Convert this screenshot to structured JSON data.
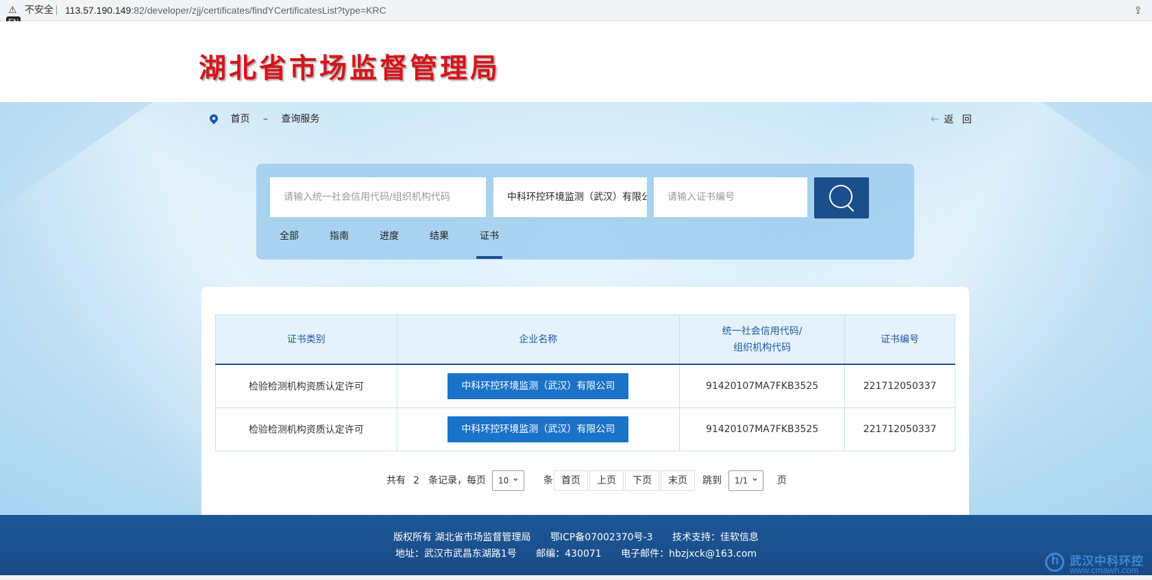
{
  "browser": {
    "warning_icon": "warning-triangle-icon",
    "insecure_label": "不安全",
    "url_host": "113.57.190.149",
    "url_rest": ":82/developer/zjj/certificates/findYCertificatesList?type=KRC",
    "share_icon": "share-icon",
    "ime_badge": "EN"
  },
  "header": {
    "title": "湖北省市场监督管理局",
    "title_color": "#d5141b"
  },
  "breadcrumb": {
    "icon": "location-pin-icon",
    "home": "首页",
    "separator": "–",
    "current": "查询服务"
  },
  "back": {
    "icon": "arrow-left-icon",
    "label": "返 回"
  },
  "search": {
    "credit_code_placeholder": "请输入统一社会信用代码/组织机构代码",
    "company_value": "中科环控环境监测（武汉）有限公司",
    "certificate_placeholder": "请输入证书编号",
    "search_icon": "search-icon",
    "button_color": "#1a4f8c"
  },
  "tabs": [
    {
      "label": "全部"
    },
    {
      "label": "指南"
    },
    {
      "label": "进度"
    },
    {
      "label": "结果"
    },
    {
      "label": "证书",
      "active": true
    }
  ],
  "table": {
    "headers": {
      "category": "证书类别",
      "company": "企业名称",
      "credit_code_line1": "统一社会信用代码/",
      "credit_code_line2": "组织机构代码",
      "cert_no": "证书编号"
    },
    "rows": [
      {
        "category": "检验检测机构资质认定许可",
        "company": "中科环控环境监测（武汉）有限公司",
        "credit_code": "91420107MA7FKB3525",
        "cert_no": "221712050337"
      },
      {
        "category": "检验检测机构资质认定许可",
        "company": "中科环控环境监测（武汉）有限公司",
        "credit_code": "91420107MA7FKB3525",
        "cert_no": "221712050337"
      }
    ]
  },
  "pager": {
    "total_prefix": "共有",
    "total": "2",
    "records_per_page": "条记录，每页",
    "page_size": "10",
    "unit": "条",
    "first": "首页",
    "prev": "上页",
    "next": "下页",
    "last": "末页",
    "jump": "跳到",
    "page_value": "1/1",
    "page_unit": "页"
  },
  "footer": {
    "copyright": "版权所有 湖北省市场监督管理局",
    "icp": "鄂ICP备07002370号-3",
    "tech": "技术支持：佳软信息",
    "address": "地址：武汉市武昌东湖路1号",
    "postcode": "邮编：430071",
    "email": "电子邮件：hbzjxck@163.com",
    "color": "#1d5797"
  },
  "watermark": {
    "name": "武汉中科环控",
    "site": "www.cmawh.com"
  }
}
